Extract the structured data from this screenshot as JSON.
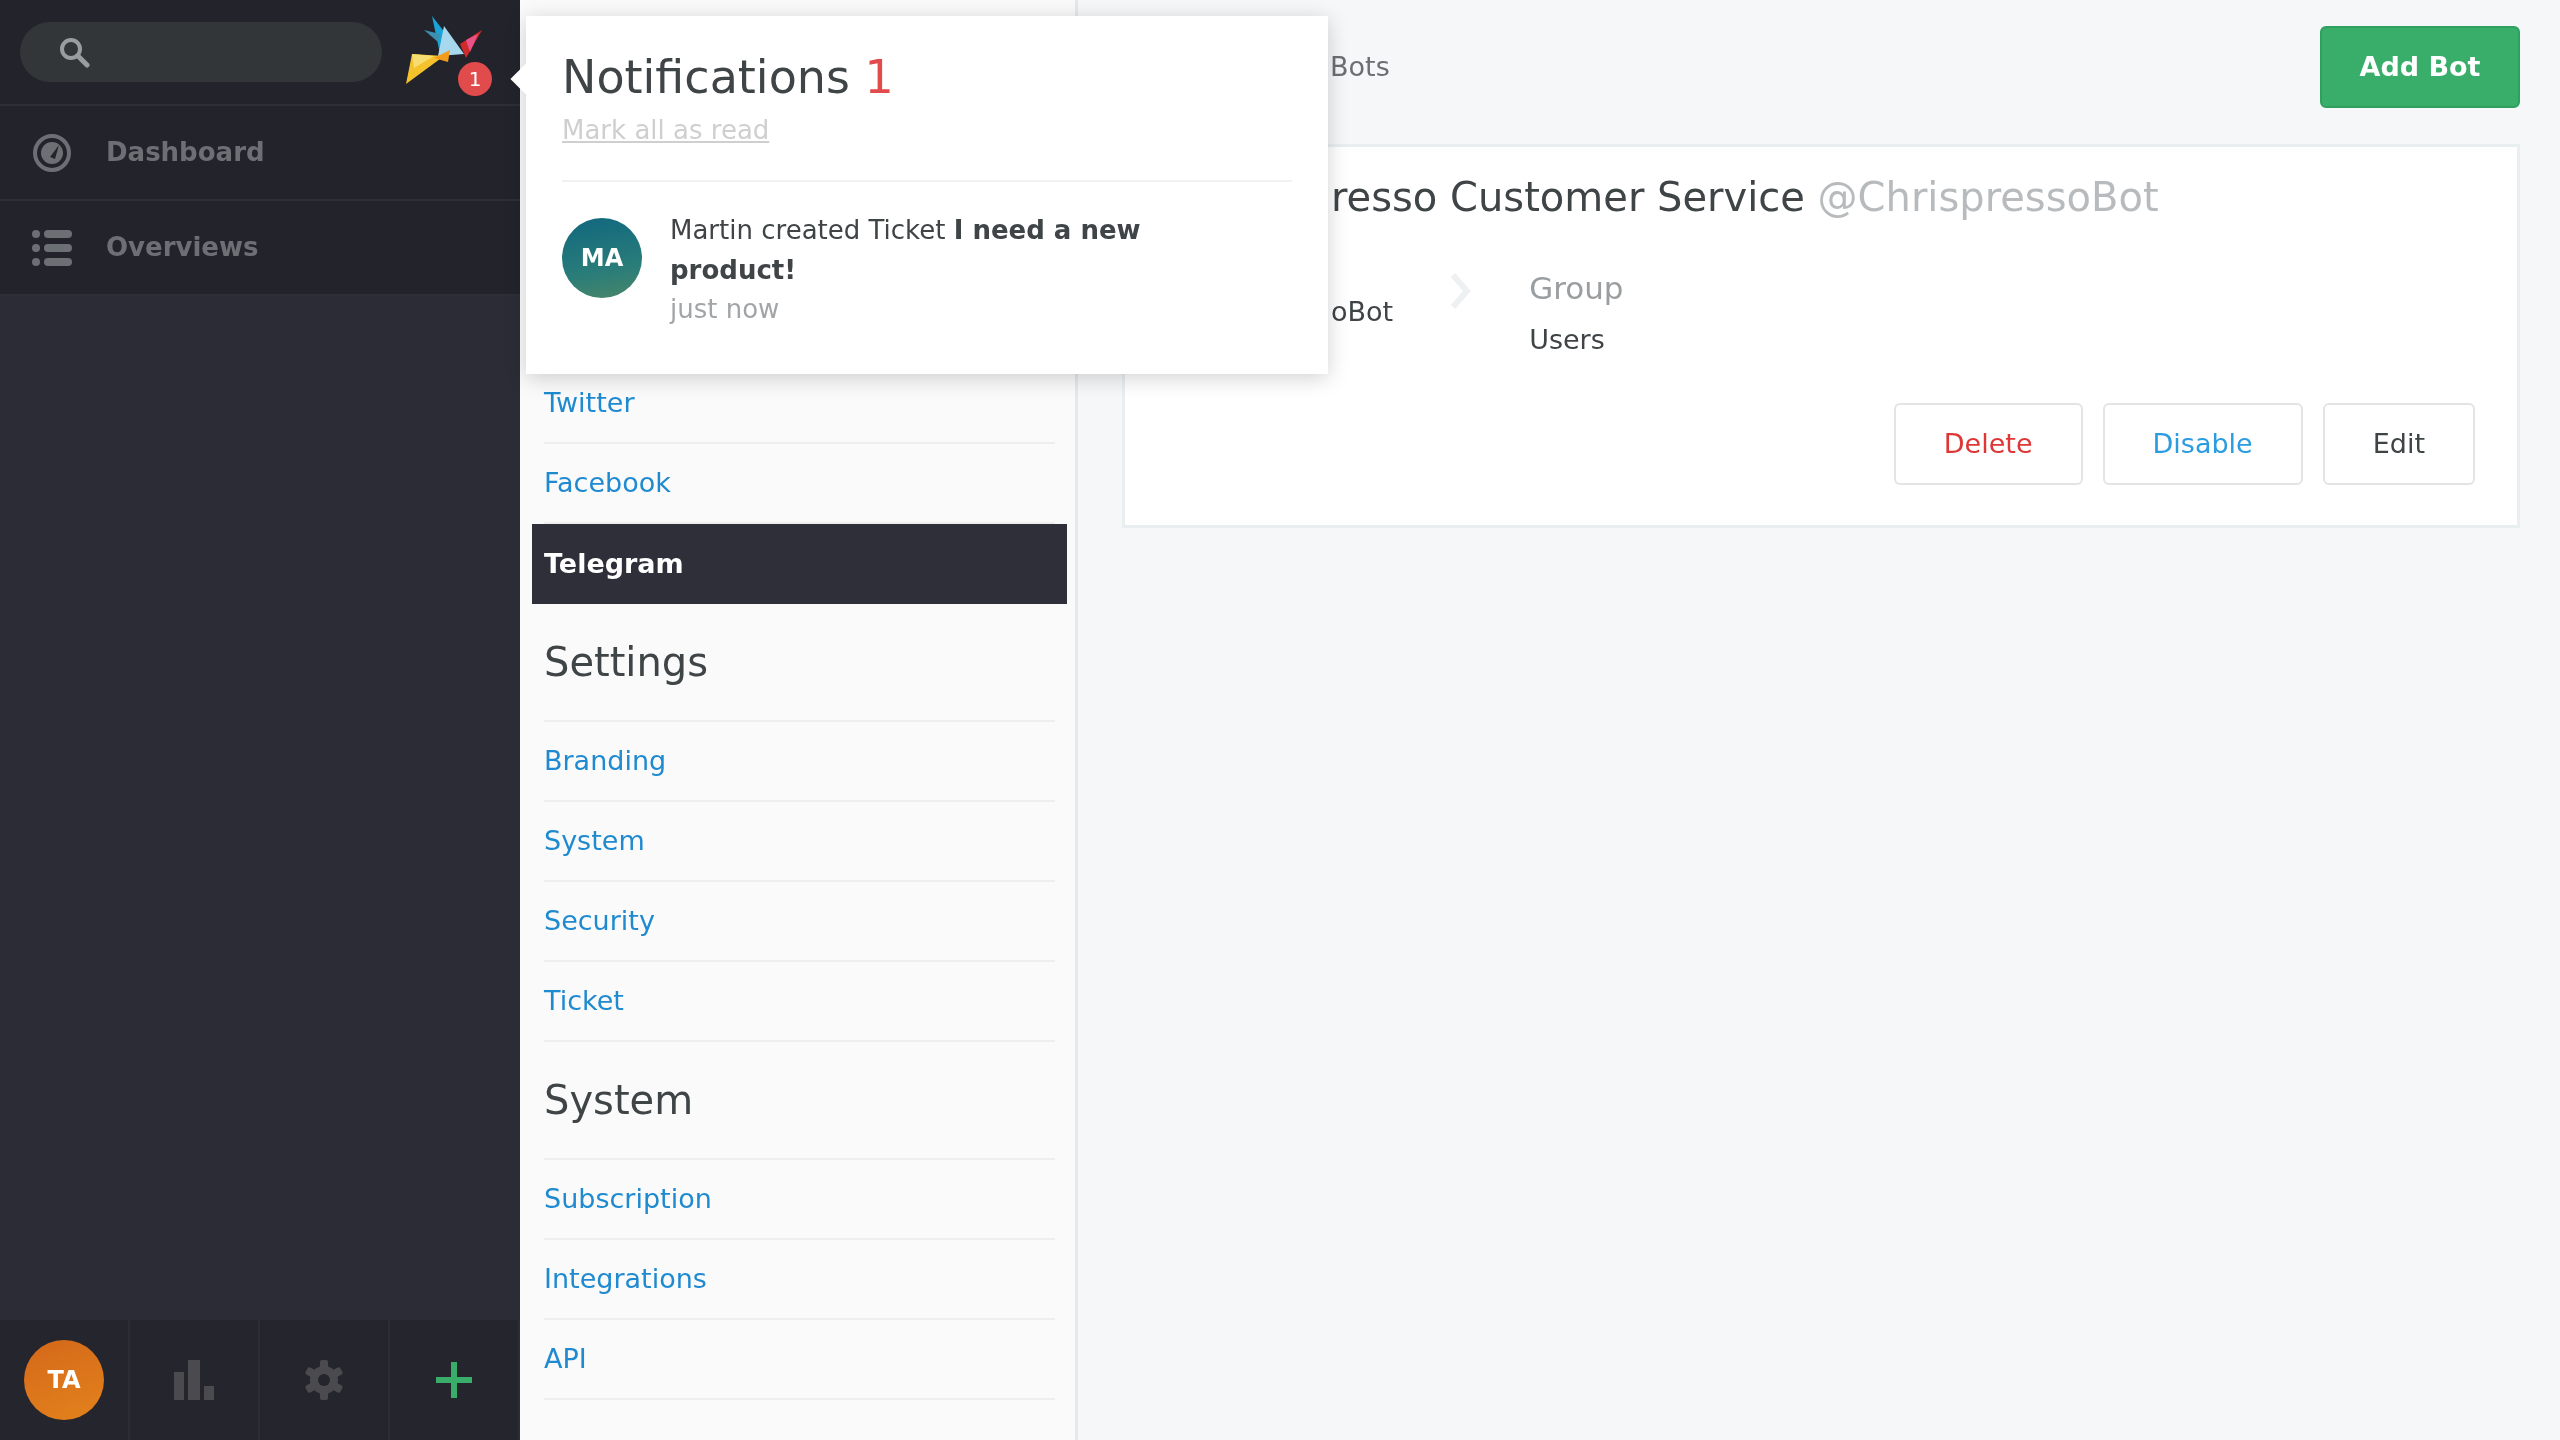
{
  "sidebar": {
    "notification_badge": "1",
    "nav_items": [
      {
        "label": "Dashboard",
        "kind": "dashboard"
      },
      {
        "label": "Overviews",
        "kind": "list"
      }
    ],
    "user_avatar": "TA"
  },
  "admin_nav": {
    "sections": [
      {
        "items": [
          {
            "label": "Twitter",
            "selected": false
          },
          {
            "label": "Facebook",
            "selected": false
          },
          {
            "label": "Telegram",
            "selected": true
          }
        ]
      },
      {
        "heading": "Settings",
        "items": [
          {
            "label": "Branding",
            "selected": false
          },
          {
            "label": "System",
            "selected": false
          },
          {
            "label": "Security",
            "selected": false
          },
          {
            "label": "Ticket",
            "selected": false
          }
        ]
      },
      {
        "heading": "System",
        "items": [
          {
            "label": "Subscription",
            "selected": false
          },
          {
            "label": "Integrations",
            "selected": false
          },
          {
            "label": "API",
            "selected": false
          }
        ]
      }
    ]
  },
  "main": {
    "breadcrumb": "Bots",
    "add_button": "Add Bot",
    "bots": [
      {
        "name": "resso Customer Service",
        "username": "@ChrispressoBot",
        "from_value": "oBot",
        "group_label": "Group",
        "group_value": "Users",
        "buttons": [
          {
            "label": "Delete",
            "kind": "danger"
          },
          {
            "label": "Disable",
            "kind": "primary"
          },
          {
            "label": "Edit",
            "kind": "default"
          }
        ]
      }
    ]
  },
  "notifications": {
    "title": "Notifications",
    "count": "1",
    "mark_all": "Mark all as read",
    "items": [
      {
        "avatar": "MA",
        "text": "Martin created Ticket **I need a new product!**",
        "time": "just now"
      }
    ]
  }
}
